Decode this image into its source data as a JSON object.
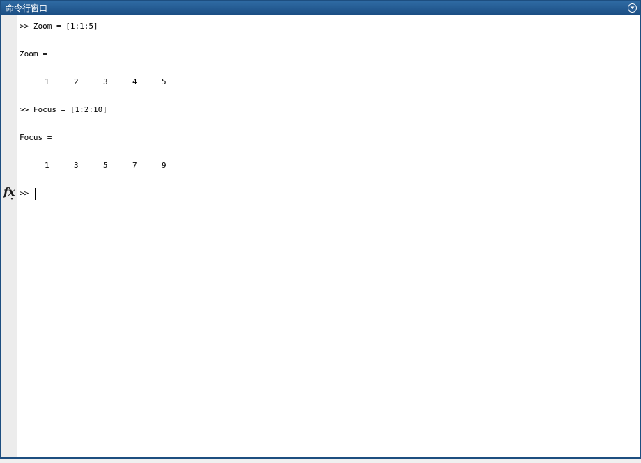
{
  "window": {
    "title": "命令行窗口",
    "menu_icon": "chevron-down-circle-icon"
  },
  "gutter": {
    "function_icon": "fx"
  },
  "console": {
    "entries": [
      {
        "prompt": ">> ",
        "command": "Zoom = [1:1:5]"
      },
      {
        "output_label": "Zoom ="
      },
      {
        "values": [
          "1",
          "2",
          "3",
          "4",
          "5"
        ]
      },
      {
        "prompt": ">> ",
        "command": "Focus = [1:2:10]"
      },
      {
        "output_label": "Focus ="
      },
      {
        "values": [
          "1",
          "3",
          "5",
          "7",
          "9"
        ]
      }
    ],
    "active_prompt": ">>"
  }
}
